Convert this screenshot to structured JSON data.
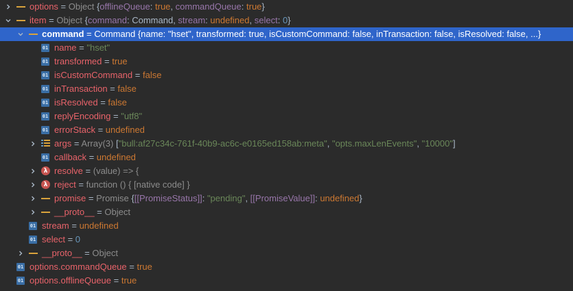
{
  "colors": {
    "background": "#2b2b2b",
    "selection": "#2f65ca",
    "variable_name": "#e8636a",
    "string": "#6a8759",
    "keyword": "#cc7832",
    "number": "#6897bb",
    "type": "#8c8c8c",
    "property": "#9876aa",
    "object_icon": "#d9a33c",
    "function_icon": "#c75450",
    "field_icon": "#3a6ea5"
  },
  "rows": [
    {
      "depth": 0,
      "expander": "collapsed",
      "icon": "object-icon",
      "selected": false,
      "segments": [
        {
          "t": "options",
          "c": "name"
        },
        {
          "t": " = ",
          "c": "eq"
        },
        {
          "t": "Object ",
          "c": "type"
        },
        {
          "t": "{",
          "c": "text"
        },
        {
          "t": "offlineQueue",
          "c": "prop"
        },
        {
          "t": ": ",
          "c": "text"
        },
        {
          "t": "true",
          "c": "bool"
        },
        {
          "t": ", ",
          "c": "text"
        },
        {
          "t": "commandQueue",
          "c": "prop"
        },
        {
          "t": ": ",
          "c": "text"
        },
        {
          "t": "true",
          "c": "bool"
        },
        {
          "t": "}",
          "c": "text"
        }
      ]
    },
    {
      "depth": 0,
      "expander": "expanded",
      "icon": "object-icon",
      "selected": false,
      "segments": [
        {
          "t": "item",
          "c": "name"
        },
        {
          "t": " = ",
          "c": "eq"
        },
        {
          "t": "Object ",
          "c": "type"
        },
        {
          "t": "{",
          "c": "text"
        },
        {
          "t": "command",
          "c": "prop"
        },
        {
          "t": ": Command, ",
          "c": "text"
        },
        {
          "t": "stream",
          "c": "prop"
        },
        {
          "t": ": ",
          "c": "text"
        },
        {
          "t": "undefined",
          "c": "undef"
        },
        {
          "t": ", ",
          "c": "text"
        },
        {
          "t": "select",
          "c": "prop"
        },
        {
          "t": ": ",
          "c": "text"
        },
        {
          "t": "0",
          "c": "num"
        },
        {
          "t": "}",
          "c": "text"
        }
      ]
    },
    {
      "depth": 1,
      "expander": "expanded",
      "icon": "object-icon",
      "selected": true,
      "segments": [
        {
          "t": "command",
          "c": "name"
        },
        {
          "t": " = ",
          "c": "eq"
        },
        {
          "t": "Command {name: \"hset\", transformed: true, isCustomCommand: false, inTransaction: false, isResolved: false, ...}",
          "c": "text"
        }
      ]
    },
    {
      "depth": 2,
      "expander": "none",
      "icon": "field-icon",
      "selected": false,
      "segments": [
        {
          "t": "name",
          "c": "name"
        },
        {
          "t": " = ",
          "c": "eq"
        },
        {
          "t": "\"hset\"",
          "c": "str"
        }
      ]
    },
    {
      "depth": 2,
      "expander": "none",
      "icon": "field-icon",
      "selected": false,
      "segments": [
        {
          "t": "transformed",
          "c": "name"
        },
        {
          "t": " = ",
          "c": "eq"
        },
        {
          "t": "true",
          "c": "bool"
        }
      ]
    },
    {
      "depth": 2,
      "expander": "none",
      "icon": "field-icon",
      "selected": false,
      "segments": [
        {
          "t": "isCustomCommand",
          "c": "name"
        },
        {
          "t": " = ",
          "c": "eq"
        },
        {
          "t": "false",
          "c": "bool"
        }
      ]
    },
    {
      "depth": 2,
      "expander": "none",
      "icon": "field-icon",
      "selected": false,
      "segments": [
        {
          "t": "inTransaction",
          "c": "name"
        },
        {
          "t": " = ",
          "c": "eq"
        },
        {
          "t": "false",
          "c": "bool"
        }
      ]
    },
    {
      "depth": 2,
      "expander": "none",
      "icon": "field-icon",
      "selected": false,
      "segments": [
        {
          "t": "isResolved",
          "c": "name"
        },
        {
          "t": " = ",
          "c": "eq"
        },
        {
          "t": "false",
          "c": "bool"
        }
      ]
    },
    {
      "depth": 2,
      "expander": "none",
      "icon": "field-icon",
      "selected": false,
      "segments": [
        {
          "t": "replyEncoding",
          "c": "name"
        },
        {
          "t": " = ",
          "c": "eq"
        },
        {
          "t": "\"utf8\"",
          "c": "str"
        }
      ]
    },
    {
      "depth": 2,
      "expander": "none",
      "icon": "field-icon",
      "selected": false,
      "segments": [
        {
          "t": "errorStack",
          "c": "name"
        },
        {
          "t": " = ",
          "c": "eq"
        },
        {
          "t": "undefined",
          "c": "undef"
        }
      ]
    },
    {
      "depth": 2,
      "expander": "collapsed",
      "icon": "array-icon",
      "selected": false,
      "segments": [
        {
          "t": "args",
          "c": "name"
        },
        {
          "t": " = ",
          "c": "eq"
        },
        {
          "t": "Array(3) ",
          "c": "type"
        },
        {
          "t": "[",
          "c": "text"
        },
        {
          "t": "\"bull:af27c34c-761f-40b9-ac6c-e0165ed158ab:meta\"",
          "c": "str"
        },
        {
          "t": ", ",
          "c": "text"
        },
        {
          "t": "\"opts.maxLenEvents\"",
          "c": "str"
        },
        {
          "t": ", ",
          "c": "text"
        },
        {
          "t": "\"10000\"",
          "c": "str"
        },
        {
          "t": "]",
          "c": "text"
        }
      ]
    },
    {
      "depth": 2,
      "expander": "none",
      "icon": "field-icon",
      "selected": false,
      "segments": [
        {
          "t": "callback",
          "c": "name"
        },
        {
          "t": " = ",
          "c": "eq"
        },
        {
          "t": "undefined",
          "c": "undef"
        }
      ]
    },
    {
      "depth": 2,
      "expander": "collapsed",
      "icon": "function-icon",
      "selected": false,
      "segments": [
        {
          "t": "resolve",
          "c": "name"
        },
        {
          "t": " = ",
          "c": "eq"
        },
        {
          "t": "(value) => {",
          "c": "type"
        }
      ]
    },
    {
      "depth": 2,
      "expander": "collapsed",
      "icon": "function-icon",
      "selected": false,
      "segments": [
        {
          "t": "reject",
          "c": "name"
        },
        {
          "t": " = ",
          "c": "eq"
        },
        {
          "t": "function () { [native code] }",
          "c": "type"
        }
      ]
    },
    {
      "depth": 2,
      "expander": "collapsed",
      "icon": "object-icon",
      "selected": false,
      "segments": [
        {
          "t": "promise",
          "c": "name"
        },
        {
          "t": " = ",
          "c": "eq"
        },
        {
          "t": "Promise ",
          "c": "type"
        },
        {
          "t": "{",
          "c": "text"
        },
        {
          "t": "[[PromiseStatus]]",
          "c": "prop"
        },
        {
          "t": ": ",
          "c": "text"
        },
        {
          "t": "\"pending\"",
          "c": "str"
        },
        {
          "t": ", ",
          "c": "text"
        },
        {
          "t": "[[PromiseValue]]",
          "c": "prop"
        },
        {
          "t": ": ",
          "c": "text"
        },
        {
          "t": "undefined",
          "c": "undef"
        },
        {
          "t": "}",
          "c": "text"
        }
      ]
    },
    {
      "depth": 2,
      "expander": "collapsed",
      "icon": "object-icon",
      "selected": false,
      "segments": [
        {
          "t": "__proto__",
          "c": "name"
        },
        {
          "t": " = ",
          "c": "eq"
        },
        {
          "t": "Object",
          "c": "type"
        }
      ]
    },
    {
      "depth": 1,
      "expander": "none",
      "icon": "field-icon",
      "selected": false,
      "segments": [
        {
          "t": "stream",
          "c": "name"
        },
        {
          "t": " = ",
          "c": "eq"
        },
        {
          "t": "undefined",
          "c": "undef"
        }
      ]
    },
    {
      "depth": 1,
      "expander": "none",
      "icon": "field-icon",
      "selected": false,
      "segments": [
        {
          "t": "select",
          "c": "name"
        },
        {
          "t": " = ",
          "c": "eq"
        },
        {
          "t": "0",
          "c": "num"
        }
      ]
    },
    {
      "depth": 1,
      "expander": "collapsed",
      "icon": "object-icon",
      "selected": false,
      "segments": [
        {
          "t": "__proto__",
          "c": "name"
        },
        {
          "t": " = ",
          "c": "eq"
        },
        {
          "t": "Object",
          "c": "type"
        }
      ]
    },
    {
      "depth": 0,
      "expander": "none",
      "icon": "field-icon",
      "selected": false,
      "segments": [
        {
          "t": "options.commandQueue",
          "c": "name"
        },
        {
          "t": " = ",
          "c": "eq"
        },
        {
          "t": "true",
          "c": "bool"
        }
      ]
    },
    {
      "depth": 0,
      "expander": "none",
      "icon": "field-icon",
      "selected": false,
      "segments": [
        {
          "t": "options.offlineQueue",
          "c": "name"
        },
        {
          "t": " = ",
          "c": "eq"
        },
        {
          "t": "true",
          "c": "bool"
        }
      ]
    }
  ],
  "icon_labels": {
    "field": "01",
    "function": "λ"
  }
}
